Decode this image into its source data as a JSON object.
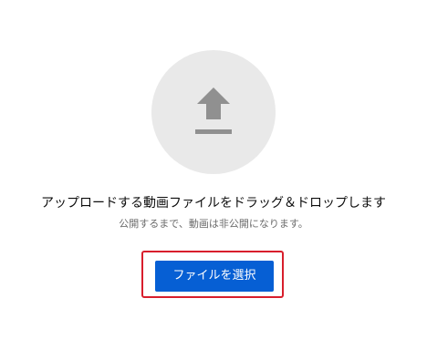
{
  "upload": {
    "icon": "upload-arrow-icon",
    "headline": "アップロードする動画ファイルをドラッグ＆ドロップします",
    "subtext": "公開するまで、動画は非公開になります。",
    "select_button_label": "ファイルを選択"
  },
  "colors": {
    "circle_bg": "#e9e9e9",
    "icon": "#909090",
    "button_bg": "#065fd4",
    "highlight_border": "#d81e2c"
  }
}
